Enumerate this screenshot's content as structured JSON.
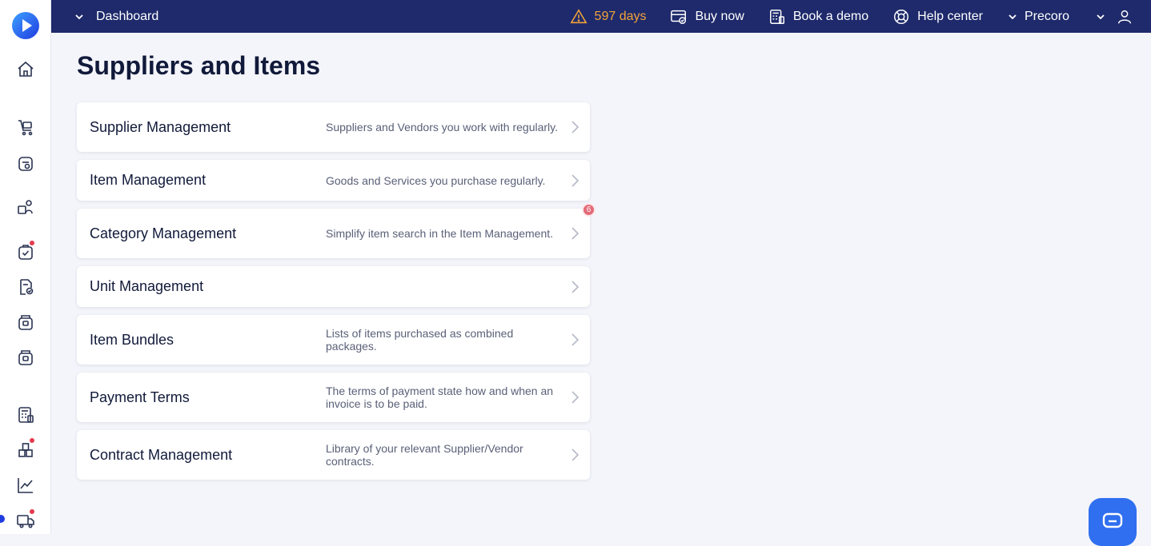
{
  "topbar": {
    "menu_label": "Dashboard",
    "trial_days": "597 days",
    "buy_now": "Buy now",
    "book_demo": "Book a demo",
    "help_center": "Help center",
    "workspace": "Precoro"
  },
  "page": {
    "title": "Suppliers and Items"
  },
  "cards": [
    {
      "name": "Supplier Management",
      "desc": "Suppliers and Vendors you work with regularly."
    },
    {
      "name": "Item Management",
      "desc": "Goods and Services you purchase regularly."
    },
    {
      "name": "Category Management",
      "desc": "Simplify item search in the Item Management."
    },
    {
      "name": "Unit Management",
      "desc": ""
    },
    {
      "name": "Item Bundles",
      "desc": "Lists of items purchased as combined packages."
    },
    {
      "name": "Payment Terms",
      "desc": "The terms of payment state how and when an invoice is to be paid."
    },
    {
      "name": "Contract Management",
      "desc": "Library of your relevant Supplier/Vendor contracts."
    }
  ],
  "category_badge": "6",
  "colors": {
    "topbar": "#1e2a6b",
    "warning": "#f2a33a",
    "badge": "#e36b78",
    "accent": "#2f6ff0"
  }
}
